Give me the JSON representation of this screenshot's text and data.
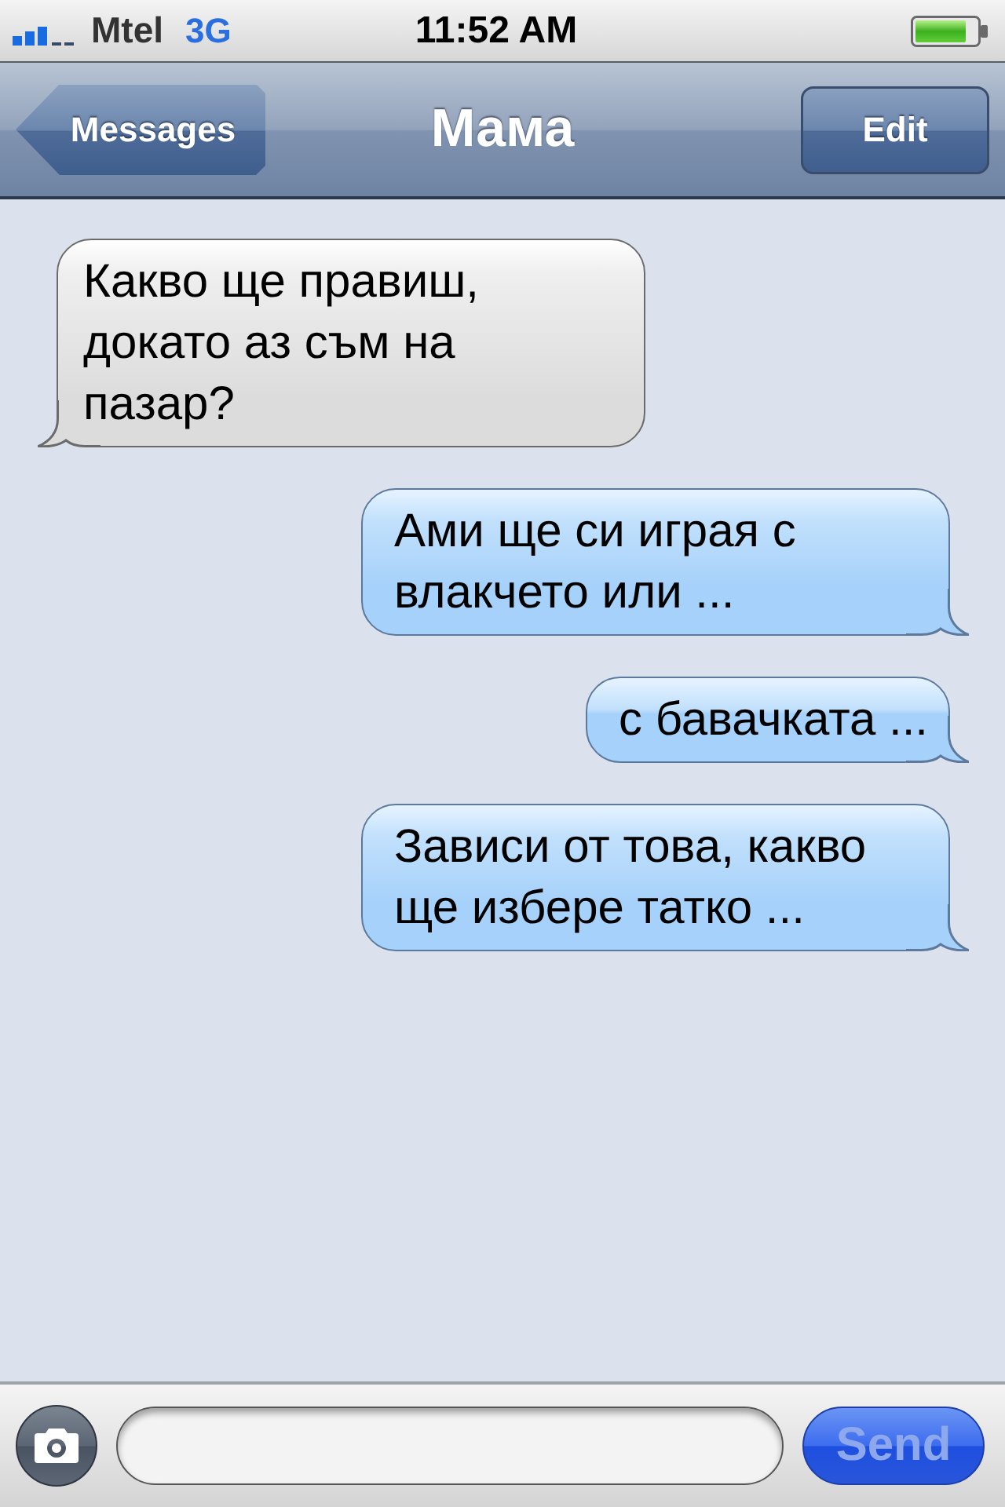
{
  "status_bar": {
    "carrier": "Mtel",
    "network": "3G",
    "time": "11:52 AM"
  },
  "nav_bar": {
    "back_button": "Messages",
    "title": "Мама",
    "edit_button": "Edit"
  },
  "messages": [
    {
      "kind": "received",
      "text": "Какво ще правиш, докато аз съм на пазар?"
    },
    {
      "kind": "sent",
      "text": "Ами ще си играя с влакчето или ..."
    },
    {
      "kind": "sent",
      "text": "с бавачката ..."
    },
    {
      "kind": "sent",
      "text": "Зависи от това, какво ще избере татко ..."
    }
  ],
  "composer": {
    "send_button": {
      "label": "Send",
      "disabled": true
    }
  }
}
